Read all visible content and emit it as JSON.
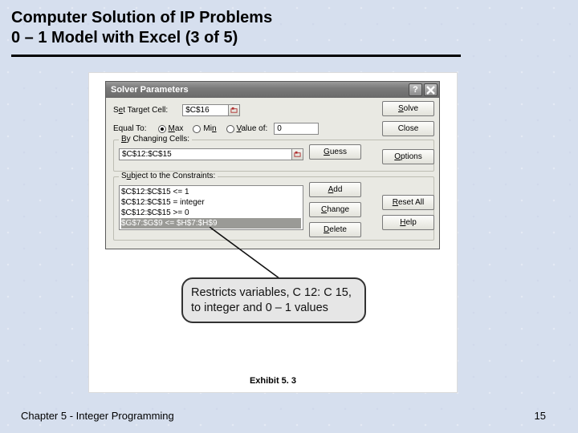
{
  "title_line1": "Computer Solution of IP Problems",
  "title_line2": "0 – 1 Model with Excel (3 of 5)",
  "dialog": {
    "title": "Solver Parameters",
    "target_label_pre": "S",
    "target_label_u": "e",
    "target_label_post": "t Target Cell:",
    "target_value": "$C$16",
    "equal_to": "Equal To:",
    "radio_max_u": "M",
    "radio_max_post": "ax",
    "radio_min_pre": "Mi",
    "radio_min_u": "n",
    "radio_value_u": "V",
    "radio_value_post": "alue of:",
    "value_of": "0",
    "changing_group_u": "B",
    "changing_group_post": "y Changing Cells:",
    "changing_value": "$C$12:$C$15",
    "constraints_group_pre": "S",
    "constraints_group_u": "u",
    "constraints_group_post": "bject to the Constraints:",
    "constraints": [
      "$C$12:$C$15 <= 1",
      "$C$12:$C$15 = integer",
      "$C$12:$C$15 >= 0",
      "$G$7:$G$9 <= $H$7:$H$9"
    ],
    "buttons": {
      "solve_u": "S",
      "solve_post": "olve",
      "close": "Close",
      "guess_u": "G",
      "guess_post": "uess",
      "add_u": "A",
      "add_post": "dd",
      "change_u": "C",
      "change_post": "hange",
      "delete_u": "D",
      "delete_post": "elete",
      "options_u": "O",
      "options_post": "ptions",
      "reset_u": "R",
      "reset_post": "eset All",
      "help_u": "H",
      "help_post": "elp"
    }
  },
  "callout": "Restricts variables, C 12: C 15, to integer and 0 – 1 values",
  "exhibit": "Exhibit 5. 3",
  "footer_left": "Chapter 5 - Integer Programming",
  "page_number": "15"
}
